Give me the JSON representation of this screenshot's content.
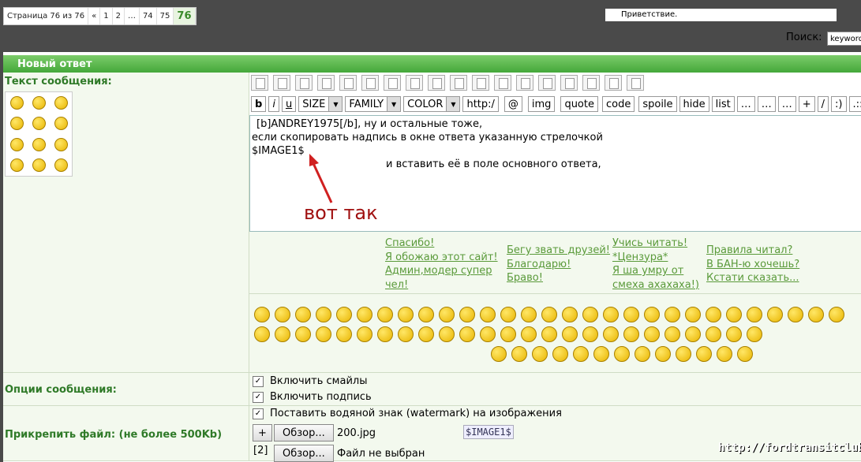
{
  "pager": {
    "info": "Страница 76 из 76",
    "first": "«",
    "p1": "1",
    "p2": "2",
    "dots": "…",
    "p74": "74",
    "p75": "75",
    "current": "76"
  },
  "greeting": "Приветствие.",
  "search": {
    "label": "Поиск:",
    "value": "keyword"
  },
  "form": {
    "header": "Новый ответ",
    "message_label": "Текст сообщения:",
    "options_label": "Опции сообщения:",
    "attach_label": "Прикрепить файл: (не более 500Kb)"
  },
  "toolbar": {
    "b": "b",
    "i": "i",
    "u": "u",
    "size": "SIZE",
    "family": "FAMILY",
    "color": "COLOR",
    "http": "http:/",
    "at": "@",
    "img": "img",
    "quote": "quote",
    "code": "code",
    "spoiler": "spoile",
    "hide": "hide",
    "list": "list",
    "dots1": "…",
    "dots2": "…",
    "dots3": "…",
    "plus": "+",
    "slash": "/",
    "smile": ":)",
    "more": ".::"
  },
  "editor": {
    "line1": "[b]ANDREY1975[/b], ну и остальные тоже,",
    "line2": "если скопировать надпись в окне ответа указанную стрелочкой",
    "line3": "$IMAGE1$",
    "line4": "и вставить её в поле основного ответа,"
  },
  "annotation": "вот так",
  "quick_links": {
    "col1": [
      "Спасибо!",
      "Я обожаю этот сайт!",
      "Админ,модер супер",
      "чел!"
    ],
    "col2": [
      "Бегу звать друзей!",
      "Благодарю!",
      "Браво!"
    ],
    "col3": [
      "Учись читать!",
      "*Цензура*",
      "Я ша умру от",
      "смеха ахахаха!)"
    ],
    "col4": [
      "Правила читал?",
      "В БАН-ю хочешь?",
      "Кстати сказать..."
    ]
  },
  "options": {
    "enable_smilies": "Включить смайлы",
    "enable_signature": "Включить подпись",
    "watermark": "Поставить водяной знак (watermark) на изображения"
  },
  "attach": {
    "add": "+",
    "browse": "Обзор...",
    "file1": "200.jpg",
    "tag": "$IMAGE1$",
    "num2": "[2]",
    "file2": "Файл не выбран"
  },
  "watermark_url": "http://fordtransitclub.ru",
  "colors": {
    "header_green": "#44a83a",
    "label_green": "#2f7a28",
    "annotation_red": "#a01010"
  }
}
